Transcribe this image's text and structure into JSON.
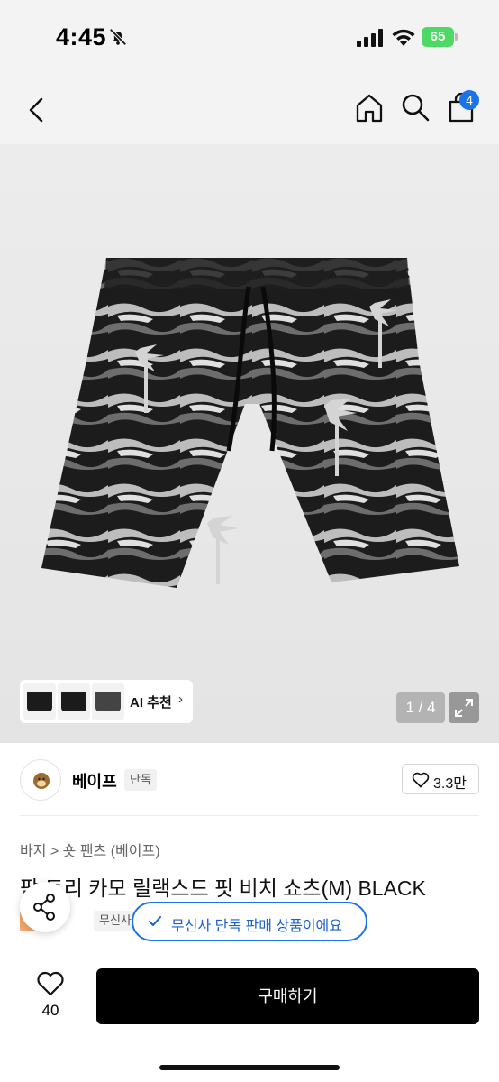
{
  "status_bar": {
    "time": "4:45",
    "battery": "65"
  },
  "nav": {
    "cart_badge": "4"
  },
  "gallery": {
    "page_indicator": "1 / 4",
    "ai_recommend_label": "AI 추천",
    "chevron": "›"
  },
  "brand": {
    "name": "베이프",
    "tag": "단독",
    "like_count": "3.3만"
  },
  "product": {
    "breadcrumb": "바지 > 숏 팬츠 (베이프)",
    "title": "팜 트리 카모 릴랙스드 핏 비치 쇼츠(M) BLACK",
    "sale_tag": "세일",
    "store_tag": "무신사"
  },
  "toast": {
    "text": "무신사 단독 판매 상품이에요"
  },
  "bottom": {
    "wish_count": "40",
    "buy_label": "구매하기"
  },
  "colors": {
    "accent_blue": "#1a73e8",
    "battery_green": "#4cd964",
    "sale_orange": "#f7a66b"
  },
  "icons": [
    "bell-off-icon",
    "signal-icon",
    "wifi-icon",
    "back-arrow-icon",
    "home-icon",
    "search-icon",
    "cart-icon",
    "expand-icon",
    "heart-icon",
    "share-icon",
    "check-icon"
  ]
}
